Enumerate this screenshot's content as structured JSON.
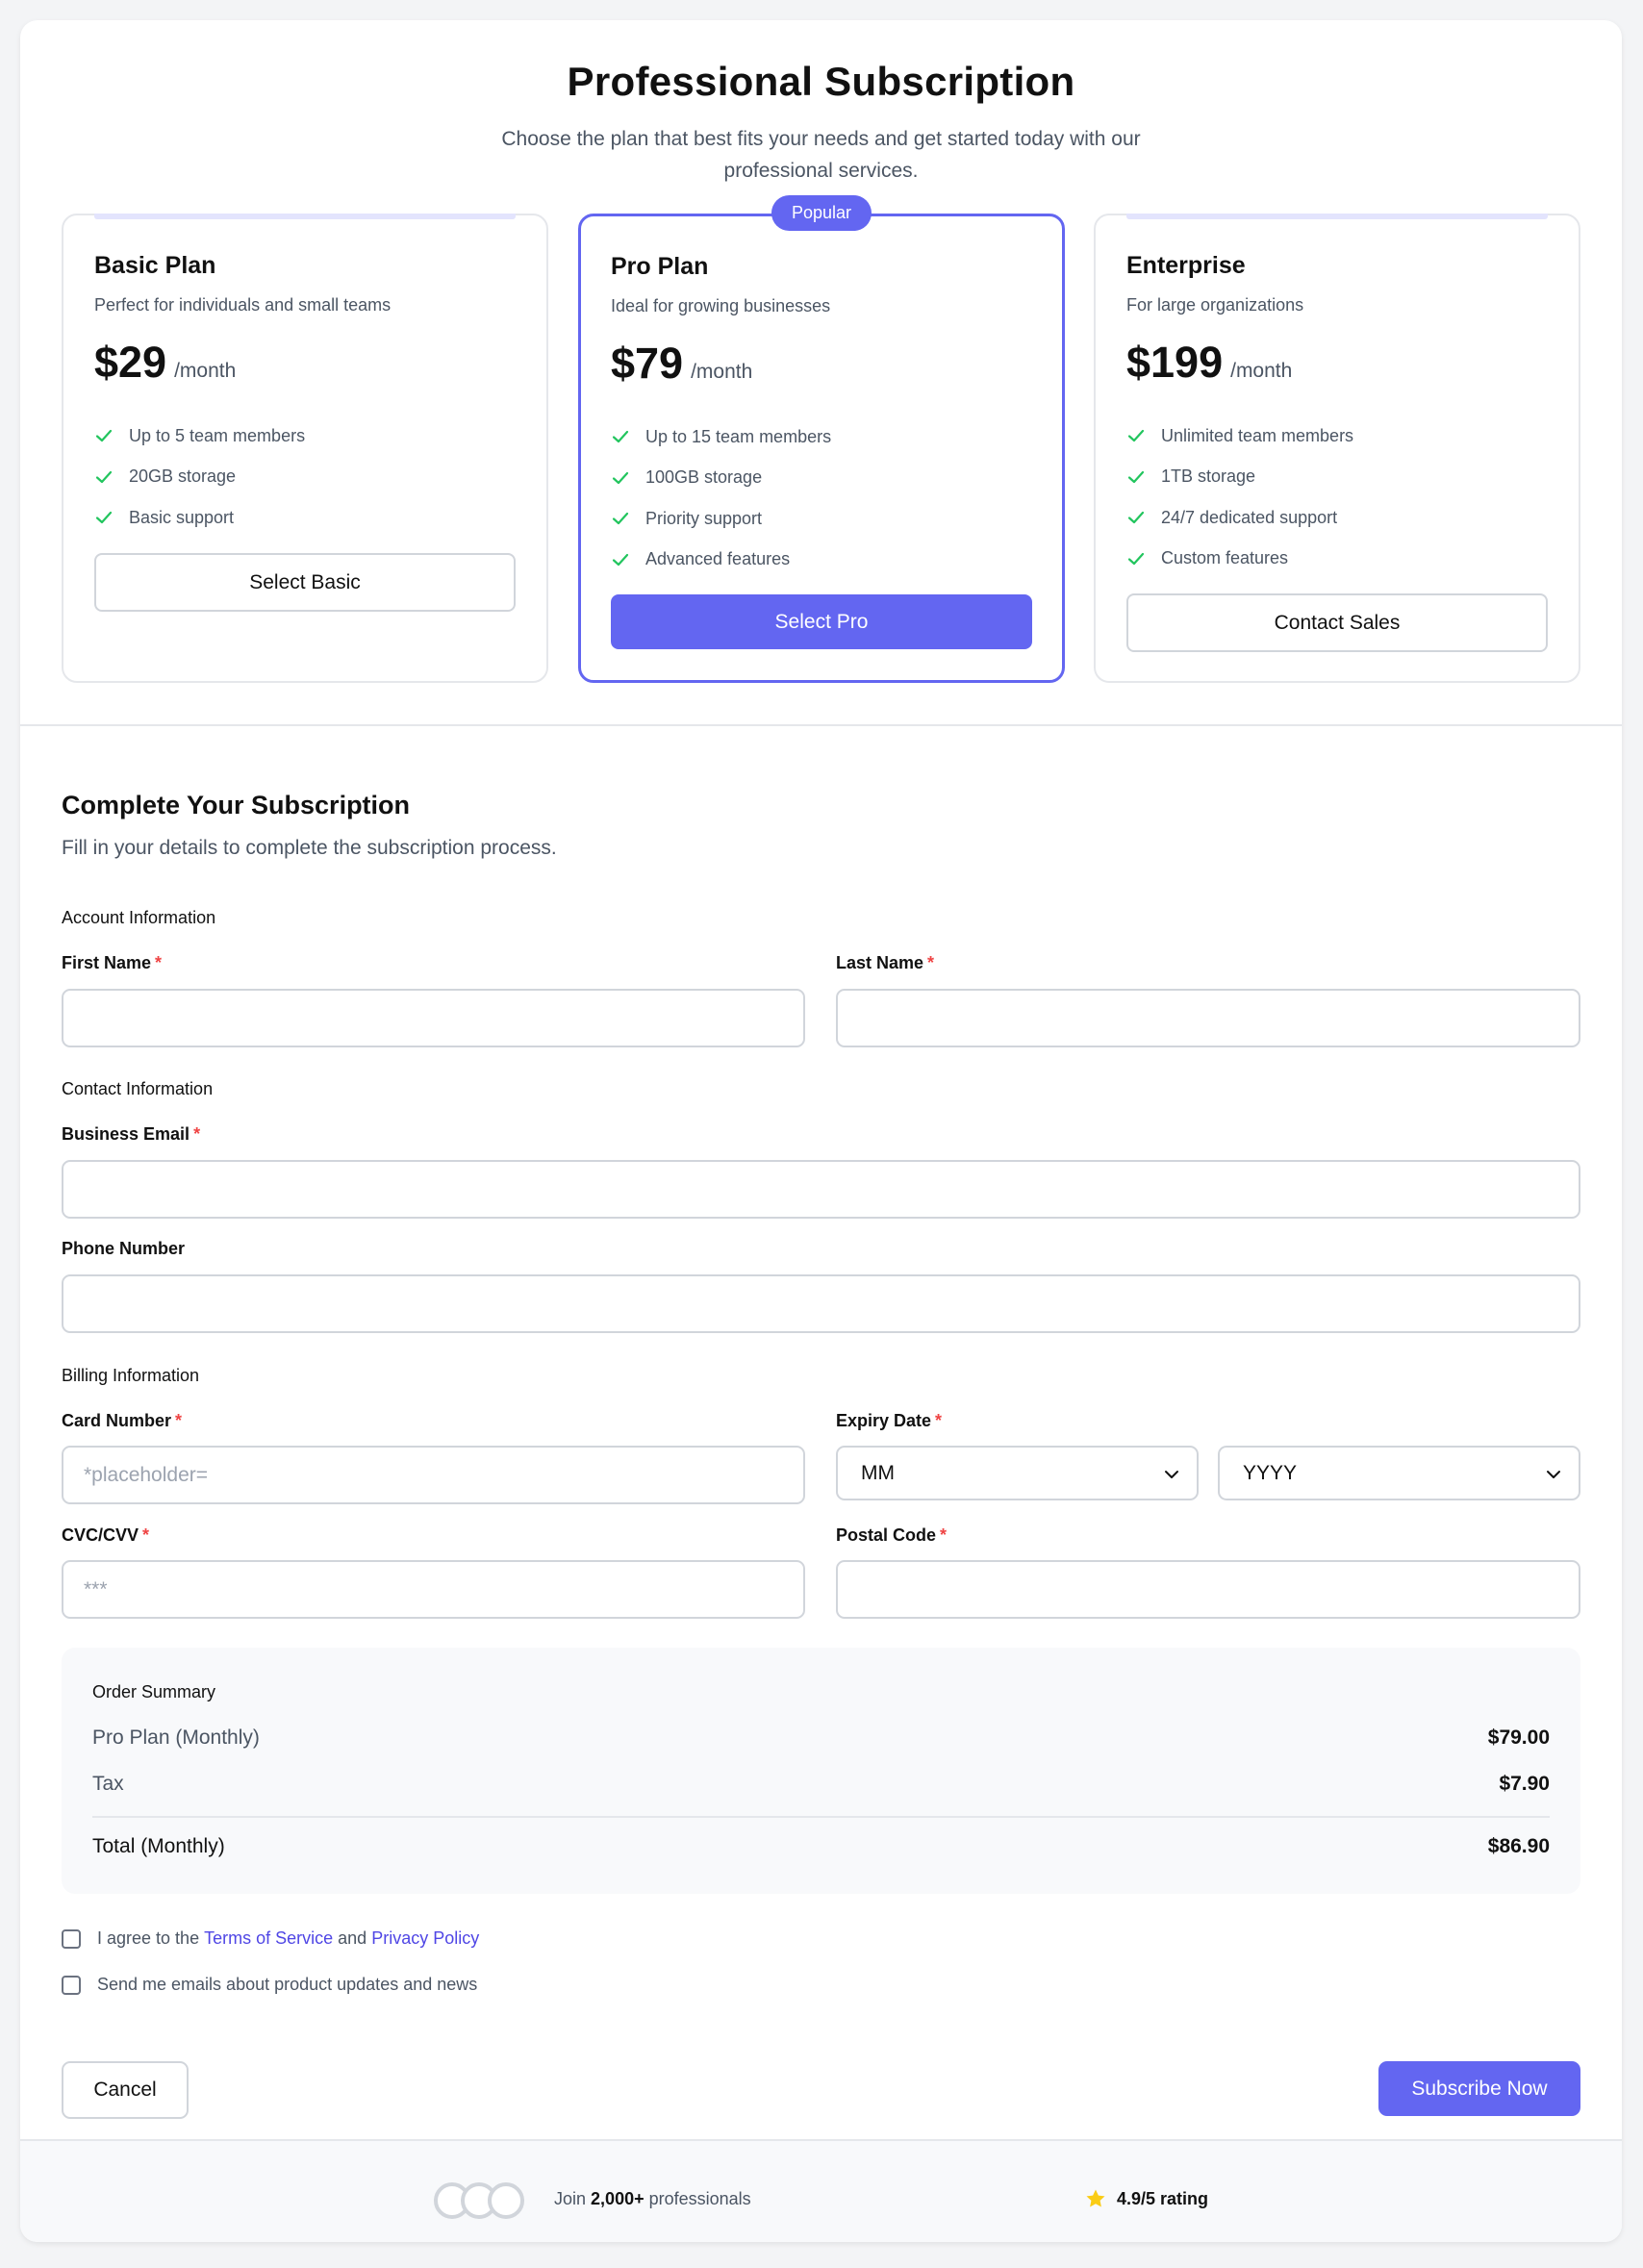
{
  "header": {
    "title": "Professional Subscription",
    "subtitle": "Choose the plan that best fits your needs and get started today with our professional services."
  },
  "plans": [
    {
      "name": "Basic Plan",
      "description": "Perfect for individuals and small teams",
      "price": "$29",
      "period": "/month",
      "features": [
        "Up to 5 team members",
        "20GB storage",
        "Basic support"
      ],
      "button": "Select Basic"
    },
    {
      "name": "Pro Plan",
      "badge": "Popular",
      "description": "Ideal for growing businesses",
      "price": "$79",
      "period": "/month",
      "features": [
        "Up to 15 team members",
        "100GB storage",
        "Priority support",
        "Advanced features"
      ],
      "button": "Select Pro"
    },
    {
      "name": "Enterprise",
      "description": "For large organizations",
      "price": "$199",
      "period": "/month",
      "features": [
        "Unlimited team members",
        "1TB storage",
        "24/7 dedicated support",
        "Custom features"
      ],
      "button": "Contact Sales"
    }
  ],
  "form": {
    "title": "Complete Your Subscription",
    "subtitle": "Fill in your details to complete the subscription process.",
    "required_marker": "*",
    "account": {
      "label": "Account Information",
      "first_name": {
        "label": "First Name",
        "value": ""
      },
      "last_name": {
        "label": "Last Name",
        "value": ""
      }
    },
    "contact": {
      "label": "Contact Information",
      "email": {
        "label": "Business Email",
        "value": ""
      },
      "phone": {
        "label": "Phone Number",
        "value": ""
      }
    },
    "billing": {
      "label": "Billing Information",
      "card_number": {
        "label": "Card Number",
        "placeholder": "*placeholder="
      },
      "expiry": {
        "label": "Expiry Date",
        "month": "MM",
        "year": "YYYY"
      },
      "cvc": {
        "label": "CVC/CVV",
        "placeholder": "***"
      },
      "postal": {
        "label": "Postal Code",
        "value": ""
      }
    }
  },
  "summary": {
    "title": "Order Summary",
    "lines": [
      {
        "label": "Pro Plan (Monthly)",
        "amount": "$79.00"
      },
      {
        "label": "Tax",
        "amount": "$7.90"
      }
    ],
    "total": {
      "label": "Total (Monthly)",
      "amount": "$86.90"
    }
  },
  "agreements": {
    "terms_prefix": "I agree to the",
    "terms_link": "Terms of Service",
    "and": "and",
    "privacy_link": "Privacy Policy",
    "newsletter": "Send me emails about product updates and news"
  },
  "actions": {
    "cancel": "Cancel",
    "subscribe": "Subscribe Now"
  },
  "footer": {
    "join_prefix": "Join",
    "join_count": "2,000+",
    "join_suffix": "professionals",
    "rating": "4.9/5 rating"
  },
  "colors": {
    "accent": "#6366f1",
    "check": "#22c55e",
    "required": "#ef4444",
    "star": "#facc15"
  },
  "icons": {
    "feature": "check-icon",
    "select": "chevron-down-icon",
    "rating": "star-icon"
  }
}
